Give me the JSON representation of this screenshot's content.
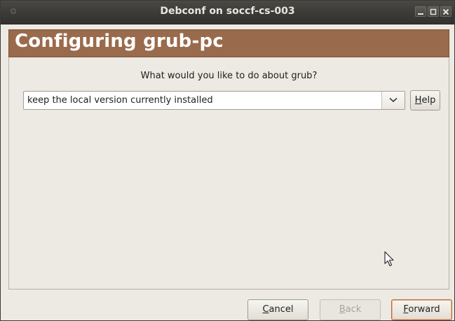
{
  "window": {
    "title": "Debconf on soccf-cs-003"
  },
  "header": {
    "title": "Configuring grub-pc"
  },
  "main": {
    "question": "What would you like to do about grub?",
    "selected_option": "keep the local version currently installed"
  },
  "buttons": {
    "help_prefix": "",
    "help_accel": "H",
    "help_rest": "elp",
    "cancel_accel": "C",
    "cancel_rest": "ancel",
    "back_accel": "B",
    "back_rest": "ack",
    "forward_accel": "F",
    "forward_rest": "orward"
  },
  "colors": {
    "header_bg": "#9a6a4c",
    "window_bg": "#ede9e3",
    "titlebar_bg": "#3a3935"
  },
  "icons": {
    "minimize": "minimize-icon",
    "maximize": "maximize-icon",
    "close": "close-icon",
    "dropdown": "chevron-down-icon",
    "cursor": "mouse-pointer-icon"
  }
}
